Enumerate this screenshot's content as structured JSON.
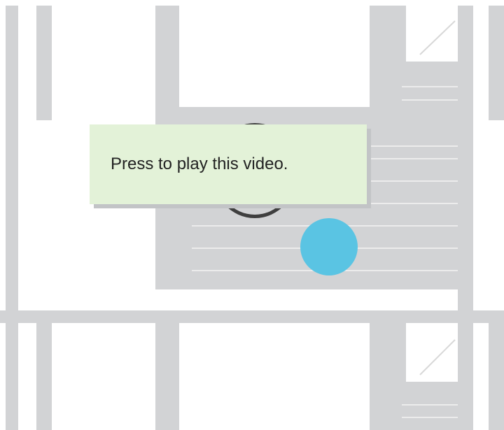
{
  "tooltip": {
    "text": "Press to play this video."
  },
  "colors": {
    "panel_gray": "#d2d3d5",
    "tooltip_bg": "#e3f2d8",
    "touch_dot": "#5ac4e3",
    "play_ring": "#3f3f3f"
  },
  "icons": {
    "play": "play-ring-icon",
    "thumbnail_corner": "image-placeholder-icon",
    "touch": "touch-indicator-icon"
  }
}
